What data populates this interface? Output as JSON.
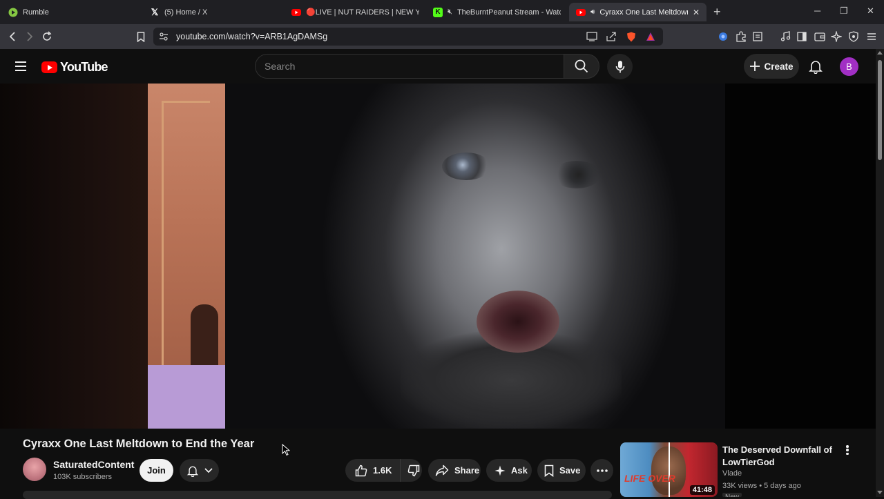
{
  "browser": {
    "tabs": [
      {
        "title": "Rumble",
        "icon": "rumble-icon",
        "active": false
      },
      {
        "title": "(5) Home / X",
        "icon": "x-icon",
        "active": false
      },
      {
        "title": "🔴LIVE | NUT RAIDERS | NEW YEAR I",
        "icon": "youtube-icon",
        "active": false
      },
      {
        "title": "TheBurntPeanut Stream - Watch l",
        "icon": "kick-icon",
        "active": false
      },
      {
        "title": "Cyraxx One Last Meltdown to",
        "icon": "youtube-icon",
        "active": true
      }
    ],
    "new_tab_label": "+",
    "url": "youtube.com/watch?v=ARB1AgDAMSg"
  },
  "youtube": {
    "logo_text": "YouTube",
    "search": {
      "placeholder": "Search"
    },
    "create_label": "Create",
    "avatar_letter": "B"
  },
  "video": {
    "title": "Cyraxx One Last Meltdown to End the Year",
    "channel": {
      "name": "SaturatedContent",
      "subscribers": "103K subscribers"
    },
    "join_label": "Join",
    "likes": "1.6K",
    "share_label": "Share",
    "ask_label": "Ask",
    "save_label": "Save"
  },
  "recommendation": {
    "title": "The Deserved Downfall of LowTierGod",
    "channel": "Vlade",
    "meta": "33K views • 5 days ago",
    "badge": "New",
    "duration": "41:48",
    "thumb_text": "LIFE OVER"
  },
  "colors": {
    "brand_red": "#ff0000",
    "background": "#0f0f0f",
    "pill": "#272727",
    "avatar": "#a12fc4"
  }
}
